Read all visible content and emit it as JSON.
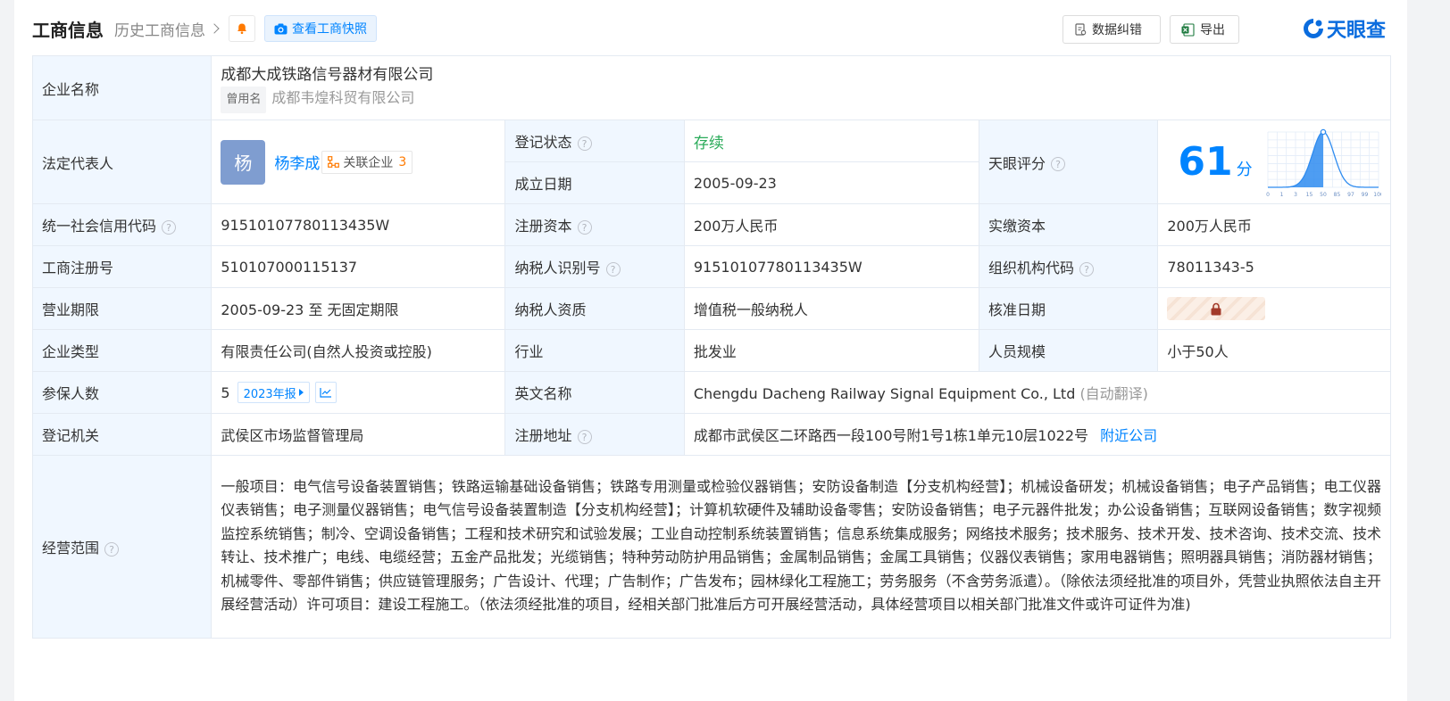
{
  "header": {
    "title": "工商信息",
    "history_link": "历史工商信息",
    "snapshot_button": "查看工商快照",
    "correction_button": "数据纠错",
    "export_button": "导出",
    "logo_text": "天眼查"
  },
  "company": {
    "name_label": "企业名称",
    "name": "成都大成铁路信号器材有限公司",
    "former_name_tag": "曾用名",
    "former_name": "成都韦煌科贸有限公司",
    "legal_rep_label": "法定代表人",
    "legal_rep_avatar": "杨",
    "legal_rep_name": "杨李成",
    "related_label": "关联企业",
    "related_count": "3",
    "reg_status_label": "登记状态",
    "reg_status": "存续",
    "found_date_label": "成立日期",
    "found_date": "2005-09-23",
    "tianyan_score_label": "天眼评分",
    "score": "61",
    "score_unit": "分",
    "credit_code_label": "统一社会信用代码",
    "credit_code": "91510107780113435W",
    "reg_capital_label": "注册资本",
    "reg_capital": "200万人民币",
    "paid_capital_label": "实缴资本",
    "paid_capital": "200万人民币",
    "reg_no_label": "工商注册号",
    "reg_no": "510107000115137",
    "taxpayer_id_label": "纳税人识别号",
    "taxpayer_id": "91510107780113435W",
    "org_code_label": "组织机构代码",
    "org_code": "78011343-5",
    "term_label": "营业期限",
    "term": "2005-09-23 至 无固定期限",
    "tax_qual_label": "纳税人资质",
    "tax_qual": "增值税一般纳税人",
    "approve_date_label": "核准日期",
    "type_label": "企业类型",
    "type": "有限责任公司(自然人投资或控股)",
    "industry_label": "行业",
    "industry": "批发业",
    "staff_label": "人员规模",
    "staff": "小于50人",
    "insured_label": "参保人数",
    "insured": "5",
    "insured_year": "2023年报",
    "en_name_label": "英文名称",
    "en_name": "Chengdu Dacheng Railway Signal Equipment Co., Ltd",
    "en_name_note": "(自动翻译)",
    "authority_label": "登记机关",
    "authority": "武侯区市场监督管理局",
    "address_label": "注册地址",
    "address": "成都市武侯区二环路西一段100号附1号1栋1单元10层1022号",
    "nearby_link": "附近公司",
    "scope_label": "经营范围",
    "scope": "一般项目：电气信号设备装置销售；铁路运输基础设备销售；铁路专用测量或检验仪器销售；安防设备制造【分支机构经营】；机械设备研发；机械设备销售；电子产品销售；电工仪器仪表销售；电子测量仪器销售；电气信号设备装置制造【分支机构经营】；计算机软硬件及辅助设备零售；安防设备销售；电子元器件批发；办公设备销售；互联网设备销售；数字视频监控系统销售；制冷、空调设备销售；工程和技术研究和试验发展；工业自动控制系统装置销售；信息系统集成服务；网络技术服务；技术服务、技术开发、技术咨询、技术交流、技术转让、技术推广；电线、电缆经营；五金产品批发；光缆销售；特种劳动防护用品销售；金属制品销售；金属工具销售；仪器仪表销售；家用电器销售；照明器具销售；消防器材销售；机械零件、零部件销售；供应链管理服务；广告设计、代理；广告制作；广告发布；园林绿化工程施工；劳务服务（不含劳务派遣）。（除依法须经批准的项目外，凭营业执照依法自主开展经营活动）许可项目：建设工程施工。（依法须经批准的项目，经相关部门批准后方可开展经营活动，具体经营项目以相关部门批准文件或许可证件为准)"
  },
  "chart_data": {
    "type": "area",
    "x": [
      "0",
      "1",
      "3",
      "15",
      "50",
      "85",
      "97",
      "99",
      "100"
    ],
    "highlight": "50",
    "score_level": 61,
    "title": "",
    "xlabel": "",
    "ylabel": ""
  },
  "colors": {
    "accent": "#0084ff",
    "status_green": "#2bab5a",
    "label_bg": "#f0f7ff",
    "related_count": "#ff7a00"
  },
  "icons": {
    "bell": "bell-icon",
    "camera": "camera-icon",
    "correction": "edit-doc-icon",
    "export": "excel-icon",
    "help": "question-circle-icon",
    "related": "network-icon",
    "lock": "lock-icon",
    "trend": "trend-line-icon"
  }
}
